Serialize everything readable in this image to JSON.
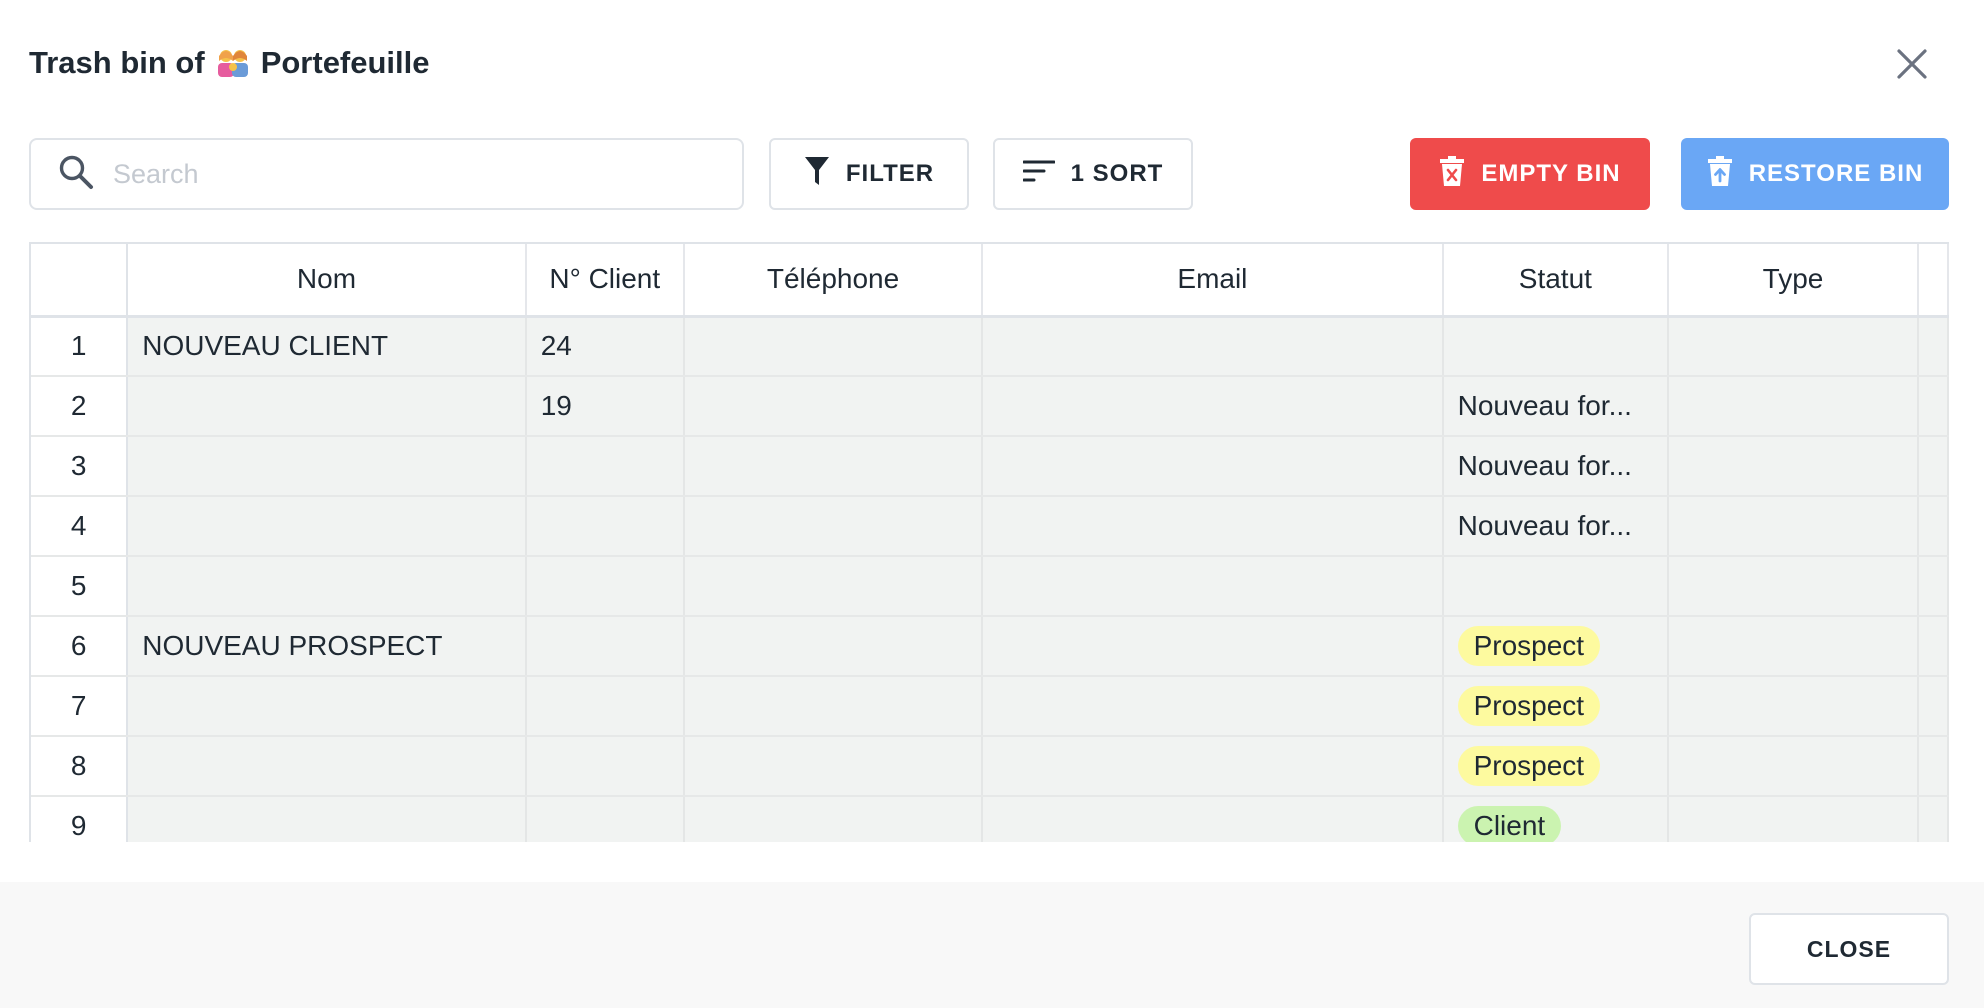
{
  "dialog": {
    "title_prefix": "Trash bin of",
    "title_icon": "family-emoji-icon",
    "title_name": "Portefeuille",
    "close_icon": "close-icon"
  },
  "toolbar": {
    "search_placeholder": "Search",
    "search_value": "",
    "filter_label": "FILTER",
    "sort_label": "1 SORT",
    "empty_label": "EMPTY BIN",
    "restore_label": "RESTORE BIN"
  },
  "colors": {
    "empty_bin": "#ef4b4b",
    "restore_bin": "#6aa7f5",
    "tag_prospect": "#fdfa9f",
    "tag_client": "#cbf3b0"
  },
  "table": {
    "columns": [
      "",
      "Nom",
      "N° Client",
      "Téléphone",
      "Email",
      "Statut",
      "Type"
    ],
    "rows": [
      {
        "num": "1",
        "nom": "NOUVEAU CLIENT",
        "client": "24",
        "tel": "",
        "email": "",
        "statut": "",
        "type": ""
      },
      {
        "num": "2",
        "nom": "",
        "client": "19",
        "tel": "",
        "email": "",
        "statut": "Nouveau for...",
        "type": ""
      },
      {
        "num": "3",
        "nom": "",
        "client": "",
        "tel": "",
        "email": "",
        "statut": "Nouveau for...",
        "type": ""
      },
      {
        "num": "4",
        "nom": "",
        "client": "",
        "tel": "",
        "email": "",
        "statut": "Nouveau for...",
        "type": ""
      },
      {
        "num": "5",
        "nom": "",
        "client": "",
        "tel": "",
        "email": "",
        "statut": "",
        "type": ""
      },
      {
        "num": "6",
        "nom": "NOUVEAU PROSPECT",
        "client": "",
        "tel": "",
        "email": "",
        "statut": "",
        "type": ""
      },
      {
        "num": "7",
        "nom": "",
        "client": "",
        "tel": "",
        "email": "",
        "statut": "",
        "type": ""
      },
      {
        "num": "8",
        "nom": "",
        "client": "",
        "tel": "",
        "email": "",
        "statut": "",
        "type": ""
      },
      {
        "num": "9",
        "nom": "",
        "client": "",
        "tel": "",
        "email": "",
        "statut": "",
        "type": ""
      }
    ],
    "tags": {
      "6": {
        "text": "Prospect",
        "kind": "prospect"
      },
      "7": {
        "text": "Prospect",
        "kind": "prospect"
      },
      "8": {
        "text": "Prospect",
        "kind": "prospect"
      },
      "9": {
        "text": "Client",
        "kind": "client"
      }
    }
  },
  "footer": {
    "close_label": "CLOSE"
  }
}
